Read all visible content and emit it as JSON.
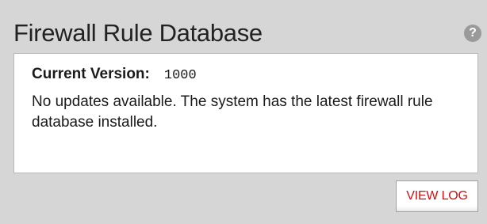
{
  "panel": {
    "title": "Firewall Rule Database",
    "help_icon_glyph": "?",
    "help_icon": "question-mark-circle"
  },
  "info": {
    "version_label": "Current Version:",
    "version_value": "1000",
    "status_message": "No updates available. The system has the latest firewall rule database installed."
  },
  "actions": {
    "view_log_label": "VIEW LOG"
  },
  "colors": {
    "background": "#d6d6d6",
    "box_background": "#ffffff",
    "button_text": "#cc1111",
    "help_icon": "#9a9a9a"
  }
}
